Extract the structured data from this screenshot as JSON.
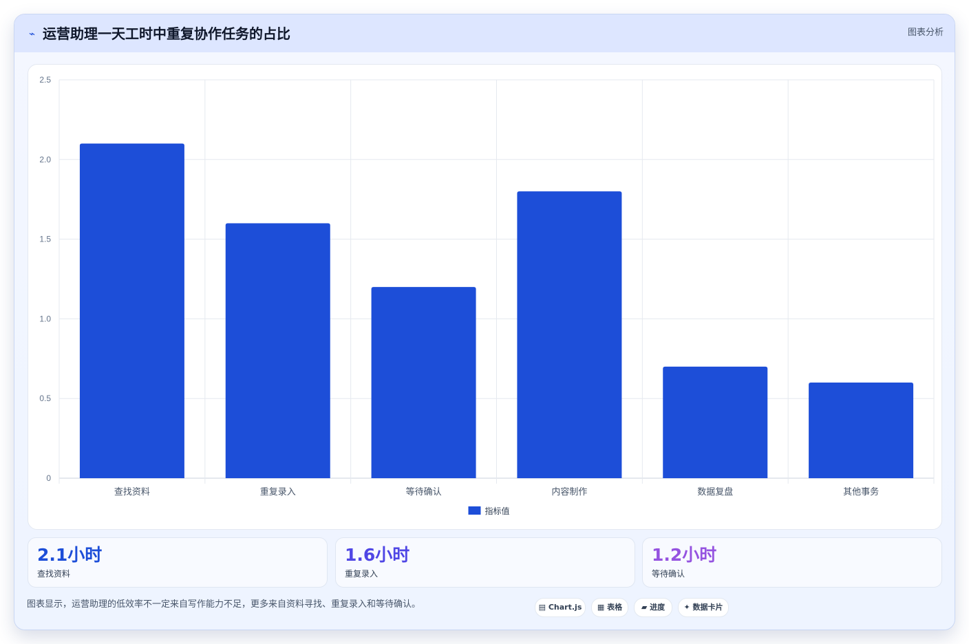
{
  "header": {
    "title": "运营助理一天工时中重复协作任务的占比",
    "tag": "图表分析",
    "icon": "chart-trend-icon"
  },
  "chart_data": {
    "type": "bar",
    "categories": [
      "查找资料",
      "重复录入",
      "等待确认",
      "内容制作",
      "数据复盘",
      "其他事务"
    ],
    "series": [
      {
        "name": "指标值",
        "values": [
          2.1,
          1.6,
          1.2,
          1.8,
          0.7,
          0.6
        ],
        "color": "#1d4ed8"
      }
    ],
    "ylim": [
      0,
      2.5
    ],
    "yticks": [
      "0",
      "0.5",
      "1.0",
      "1.5",
      "2.0",
      "2.5"
    ],
    "grid": true,
    "legend": "bottom-center"
  },
  "stats": [
    {
      "value": "2.1小时",
      "label": "查找资料",
      "color": "#1d4ed8"
    },
    {
      "value": "1.6小时",
      "label": "重复录入",
      "color": "#4f46e5"
    },
    {
      "value": "1.2小时",
      "label": "等待确认",
      "color": "#9553e0"
    }
  ],
  "footer": {
    "note": "图表显示，运营助理的低效率不一定来自写作能力不足，更多来自资料寻找、重复录入和等待确认。",
    "pills": [
      {
        "icon": "▤",
        "label": "Chart.js"
      },
      {
        "icon": "▦",
        "label": "表格"
      },
      {
        "icon": "▰",
        "label": "进度"
      },
      {
        "icon": "✦",
        "label": "数据卡片"
      }
    ]
  }
}
